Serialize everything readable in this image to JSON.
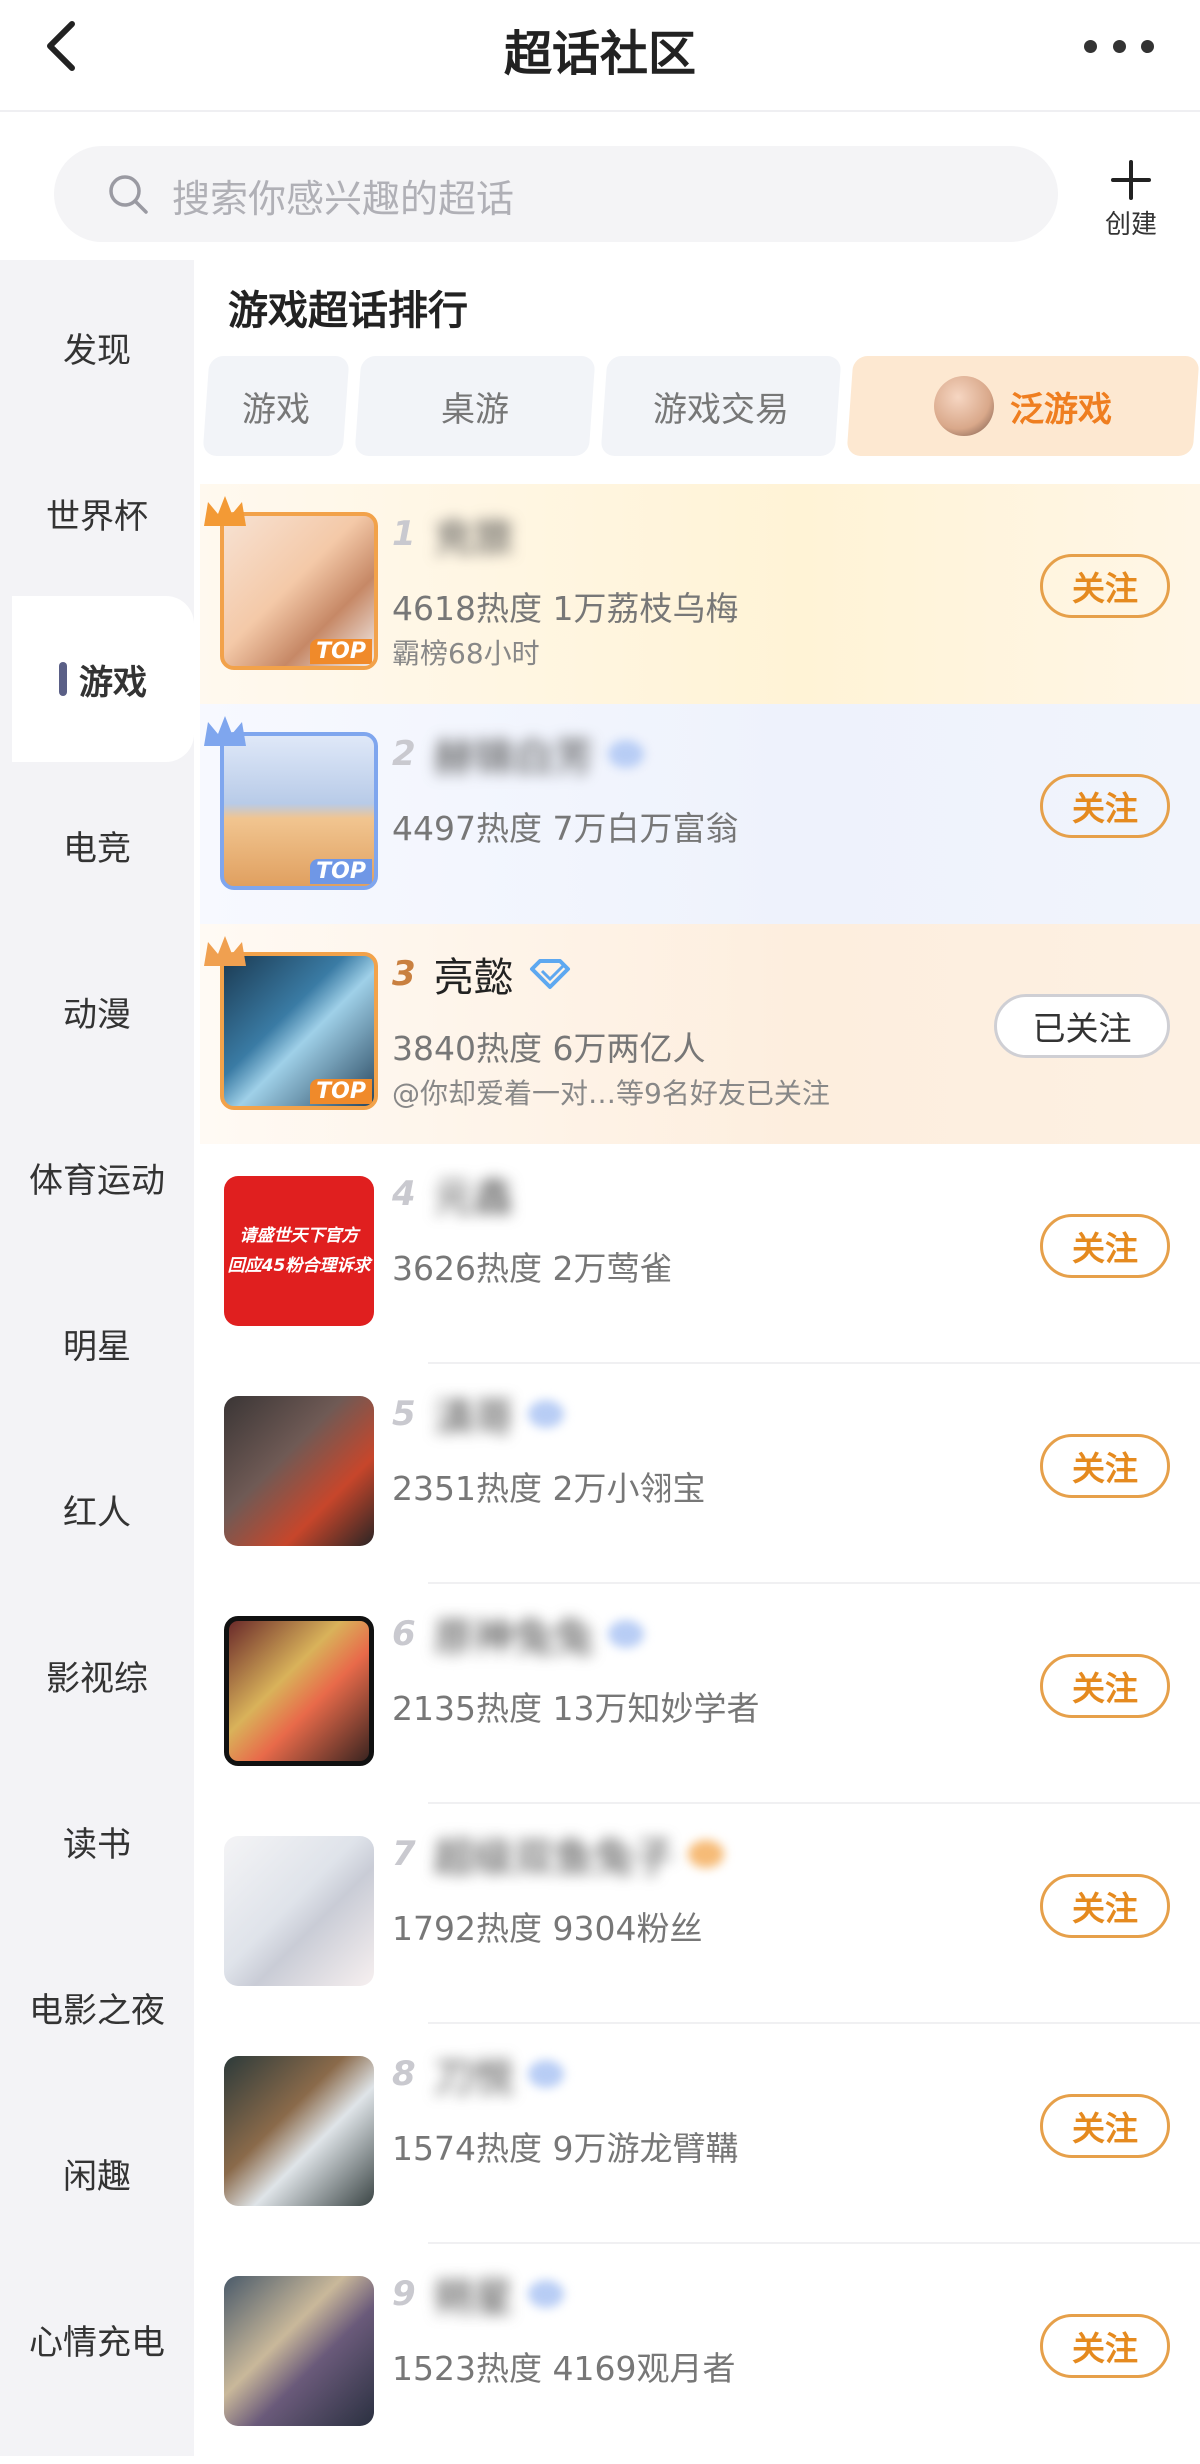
{
  "header": {
    "title": "超话社区"
  },
  "search": {
    "placeholder": "搜索你感兴趣的超话"
  },
  "create": {
    "label": "创建"
  },
  "sidebar": {
    "items": [
      {
        "label": "发现"
      },
      {
        "label": "世界杯"
      },
      {
        "label": "游戏",
        "active": true
      },
      {
        "label": "电竞"
      },
      {
        "label": "动漫"
      },
      {
        "label": "体育运动"
      },
      {
        "label": "明星"
      },
      {
        "label": "红人"
      },
      {
        "label": "影视综"
      },
      {
        "label": "读书"
      },
      {
        "label": "电影之夜"
      },
      {
        "label": "闲趣"
      },
      {
        "label": "心情充电"
      }
    ]
  },
  "section": {
    "title": "游戏超话排行"
  },
  "tabs": [
    {
      "label": "游戏"
    },
    {
      "label": "桌游"
    },
    {
      "label": "游戏交易"
    },
    {
      "label": "泛游戏",
      "active": true
    }
  ],
  "rows": [
    {
      "rank": "1",
      "name": "充旅",
      "stats": "4618热度 1万荔枝乌梅",
      "note": "霸榜68小时",
      "follow": "关注",
      "blurred": true
    },
    {
      "rank": "2",
      "name": "赫锦白芳",
      "stats": "4497热度 7万白万富翁",
      "follow": "关注",
      "blurred": true
    },
    {
      "rank": "3",
      "name": "亮懿",
      "stats": "3840热度 6万两亿人",
      "note": "@你却爱着一对…等9名好友已关注",
      "follow": "已关注",
      "blurred": false
    },
    {
      "rank": "4",
      "name": "元鑫",
      "stats": "3626热度 2万莺雀",
      "follow": "关注",
      "blurred": true,
      "thumb_text": [
        "请盛世天下官方",
        "回应45粉合理诉求"
      ]
    },
    {
      "rank": "5",
      "name": "滇哥",
      "stats": "2351热度 2万小翎宝",
      "follow": "关注",
      "blurred": true
    },
    {
      "rank": "6",
      "name": "原神兔兔",
      "stats": "2135热度 13万知妙学者",
      "follow": "关注",
      "blurred": true
    },
    {
      "rank": "7",
      "name": "超级双鱼兔子",
      "stats": "1792热度 9304粉丝",
      "follow": "关注",
      "blurred": true
    },
    {
      "rank": "8",
      "name": "刀悦",
      "stats": "1574热度 9万游龙臂鞲",
      "follow": "关注",
      "blurred": true
    },
    {
      "rank": "9",
      "name": "朔星",
      "stats": "1523热度 4169观月者",
      "follow": "关注",
      "blurred": true
    }
  ],
  "colors": {
    "accent": "#ef7e20",
    "follow_border": "#e6a04a"
  }
}
